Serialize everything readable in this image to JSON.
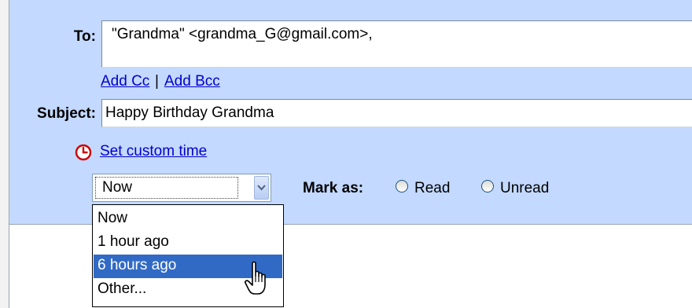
{
  "compose": {
    "to": {
      "label": "To:",
      "value": "\"Grandma\" <grandma_G@gmail.com>,"
    },
    "add_cc": "Add Cc",
    "separator": "|",
    "add_bcc": "Add Bcc",
    "subject": {
      "label": "Subject:",
      "value": "Happy Birthday Grandma"
    },
    "custom_time": {
      "icon": "clock-icon",
      "label": "Set custom time"
    },
    "time_select": {
      "selected": "Now",
      "options": [
        "Now",
        "1 hour ago",
        "6 hours ago",
        "Other..."
      ],
      "highlighted_option": "6 hours ago"
    },
    "mark_as": {
      "label": "Mark as:",
      "read": "Read",
      "unread": "Unread"
    }
  },
  "colors": {
    "header_background": "#c3d9ff",
    "link": "#0000cc",
    "clock_icon": "#cc0000",
    "option_highlight": "#316ac5"
  }
}
